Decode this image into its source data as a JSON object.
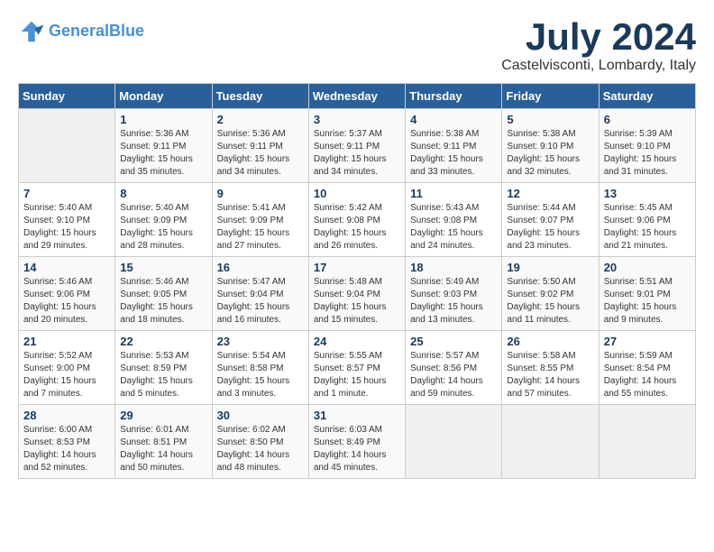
{
  "header": {
    "logo_line1": "General",
    "logo_line2": "Blue",
    "month_title": "July 2024",
    "location": "Castelvisconti, Lombardy, Italy"
  },
  "columns": [
    "Sunday",
    "Monday",
    "Tuesday",
    "Wednesday",
    "Thursday",
    "Friday",
    "Saturday"
  ],
  "weeks": [
    [
      {
        "day": "",
        "sunrise": "",
        "sunset": "",
        "daylight": ""
      },
      {
        "day": "1",
        "sunrise": "Sunrise: 5:36 AM",
        "sunset": "Sunset: 9:11 PM",
        "daylight": "Daylight: 15 hours and 35 minutes."
      },
      {
        "day": "2",
        "sunrise": "Sunrise: 5:36 AM",
        "sunset": "Sunset: 9:11 PM",
        "daylight": "Daylight: 15 hours and 34 minutes."
      },
      {
        "day": "3",
        "sunrise": "Sunrise: 5:37 AM",
        "sunset": "Sunset: 9:11 PM",
        "daylight": "Daylight: 15 hours and 34 minutes."
      },
      {
        "day": "4",
        "sunrise": "Sunrise: 5:38 AM",
        "sunset": "Sunset: 9:11 PM",
        "daylight": "Daylight: 15 hours and 33 minutes."
      },
      {
        "day": "5",
        "sunrise": "Sunrise: 5:38 AM",
        "sunset": "Sunset: 9:10 PM",
        "daylight": "Daylight: 15 hours and 32 minutes."
      },
      {
        "day": "6",
        "sunrise": "Sunrise: 5:39 AM",
        "sunset": "Sunset: 9:10 PM",
        "daylight": "Daylight: 15 hours and 31 minutes."
      }
    ],
    [
      {
        "day": "7",
        "sunrise": "Sunrise: 5:40 AM",
        "sunset": "Sunset: 9:10 PM",
        "daylight": "Daylight: 15 hours and 29 minutes."
      },
      {
        "day": "8",
        "sunrise": "Sunrise: 5:40 AM",
        "sunset": "Sunset: 9:09 PM",
        "daylight": "Daylight: 15 hours and 28 minutes."
      },
      {
        "day": "9",
        "sunrise": "Sunrise: 5:41 AM",
        "sunset": "Sunset: 9:09 PM",
        "daylight": "Daylight: 15 hours and 27 minutes."
      },
      {
        "day": "10",
        "sunrise": "Sunrise: 5:42 AM",
        "sunset": "Sunset: 9:08 PM",
        "daylight": "Daylight: 15 hours and 26 minutes."
      },
      {
        "day": "11",
        "sunrise": "Sunrise: 5:43 AM",
        "sunset": "Sunset: 9:08 PM",
        "daylight": "Daylight: 15 hours and 24 minutes."
      },
      {
        "day": "12",
        "sunrise": "Sunrise: 5:44 AM",
        "sunset": "Sunset: 9:07 PM",
        "daylight": "Daylight: 15 hours and 23 minutes."
      },
      {
        "day": "13",
        "sunrise": "Sunrise: 5:45 AM",
        "sunset": "Sunset: 9:06 PM",
        "daylight": "Daylight: 15 hours and 21 minutes."
      }
    ],
    [
      {
        "day": "14",
        "sunrise": "Sunrise: 5:46 AM",
        "sunset": "Sunset: 9:06 PM",
        "daylight": "Daylight: 15 hours and 20 minutes."
      },
      {
        "day": "15",
        "sunrise": "Sunrise: 5:46 AM",
        "sunset": "Sunset: 9:05 PM",
        "daylight": "Daylight: 15 hours and 18 minutes."
      },
      {
        "day": "16",
        "sunrise": "Sunrise: 5:47 AM",
        "sunset": "Sunset: 9:04 PM",
        "daylight": "Daylight: 15 hours and 16 minutes."
      },
      {
        "day": "17",
        "sunrise": "Sunrise: 5:48 AM",
        "sunset": "Sunset: 9:04 PM",
        "daylight": "Daylight: 15 hours and 15 minutes."
      },
      {
        "day": "18",
        "sunrise": "Sunrise: 5:49 AM",
        "sunset": "Sunset: 9:03 PM",
        "daylight": "Daylight: 15 hours and 13 minutes."
      },
      {
        "day": "19",
        "sunrise": "Sunrise: 5:50 AM",
        "sunset": "Sunset: 9:02 PM",
        "daylight": "Daylight: 15 hours and 11 minutes."
      },
      {
        "day": "20",
        "sunrise": "Sunrise: 5:51 AM",
        "sunset": "Sunset: 9:01 PM",
        "daylight": "Daylight: 15 hours and 9 minutes."
      }
    ],
    [
      {
        "day": "21",
        "sunrise": "Sunrise: 5:52 AM",
        "sunset": "Sunset: 9:00 PM",
        "daylight": "Daylight: 15 hours and 7 minutes."
      },
      {
        "day": "22",
        "sunrise": "Sunrise: 5:53 AM",
        "sunset": "Sunset: 8:59 PM",
        "daylight": "Daylight: 15 hours and 5 minutes."
      },
      {
        "day": "23",
        "sunrise": "Sunrise: 5:54 AM",
        "sunset": "Sunset: 8:58 PM",
        "daylight": "Daylight: 15 hours and 3 minutes."
      },
      {
        "day": "24",
        "sunrise": "Sunrise: 5:55 AM",
        "sunset": "Sunset: 8:57 PM",
        "daylight": "Daylight: 15 hours and 1 minute."
      },
      {
        "day": "25",
        "sunrise": "Sunrise: 5:57 AM",
        "sunset": "Sunset: 8:56 PM",
        "daylight": "Daylight: 14 hours and 59 minutes."
      },
      {
        "day": "26",
        "sunrise": "Sunrise: 5:58 AM",
        "sunset": "Sunset: 8:55 PM",
        "daylight": "Daylight: 14 hours and 57 minutes."
      },
      {
        "day": "27",
        "sunrise": "Sunrise: 5:59 AM",
        "sunset": "Sunset: 8:54 PM",
        "daylight": "Daylight: 14 hours and 55 minutes."
      }
    ],
    [
      {
        "day": "28",
        "sunrise": "Sunrise: 6:00 AM",
        "sunset": "Sunset: 8:53 PM",
        "daylight": "Daylight: 14 hours and 52 minutes."
      },
      {
        "day": "29",
        "sunrise": "Sunrise: 6:01 AM",
        "sunset": "Sunset: 8:51 PM",
        "daylight": "Daylight: 14 hours and 50 minutes."
      },
      {
        "day": "30",
        "sunrise": "Sunrise: 6:02 AM",
        "sunset": "Sunset: 8:50 PM",
        "daylight": "Daylight: 14 hours and 48 minutes."
      },
      {
        "day": "31",
        "sunrise": "Sunrise: 6:03 AM",
        "sunset": "Sunset: 8:49 PM",
        "daylight": "Daylight: 14 hours and 45 minutes."
      },
      {
        "day": "",
        "sunrise": "",
        "sunset": "",
        "daylight": ""
      },
      {
        "day": "",
        "sunrise": "",
        "sunset": "",
        "daylight": ""
      },
      {
        "day": "",
        "sunrise": "",
        "sunset": "",
        "daylight": ""
      }
    ]
  ]
}
